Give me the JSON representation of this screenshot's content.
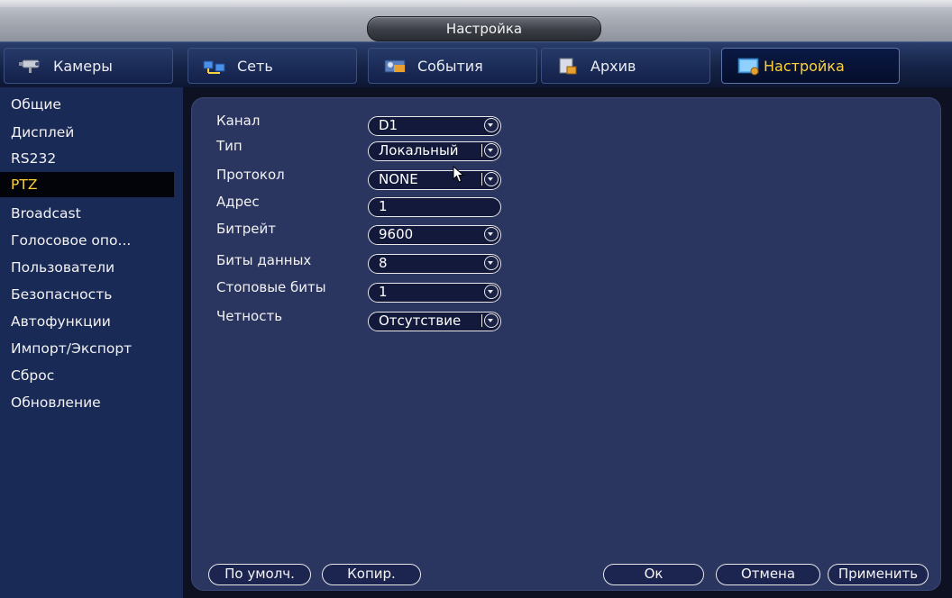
{
  "window": {
    "title": "Настройка"
  },
  "tabs": [
    {
      "label": "Камеры",
      "icon": "camera-icon"
    },
    {
      "label": "Сеть",
      "icon": "network-icon"
    },
    {
      "label": "События",
      "icon": "events-icon"
    },
    {
      "label": "Архив",
      "icon": "archive-icon"
    },
    {
      "label": "Настройка",
      "icon": "settings-icon",
      "active": true
    }
  ],
  "sidebar": {
    "items": [
      {
        "label": "Общие"
      },
      {
        "label": "Дисплей"
      },
      {
        "label": "RS232"
      },
      {
        "label": "PTZ",
        "active": true
      },
      {
        "label": "Broadcast"
      },
      {
        "label": "Голосовое опо..."
      },
      {
        "label": "Пользователи"
      },
      {
        "label": "Безопасность"
      },
      {
        "label": "Автофункции"
      },
      {
        "label": "Импорт/Экспорт"
      },
      {
        "label": "Сброс"
      },
      {
        "label": "Обновление"
      }
    ]
  },
  "form": {
    "channel": {
      "label": "Канал",
      "value": "D1",
      "dropdown": true
    },
    "type": {
      "label": "Тип",
      "value": "Локальный",
      "dropdown": true
    },
    "protocol": {
      "label": "Протокол",
      "value": "NONE",
      "dropdown": true
    },
    "address": {
      "label": "Адрес",
      "value": "1",
      "dropdown": false
    },
    "baudrate": {
      "label": "Битрейт",
      "value": "9600",
      "dropdown": true
    },
    "databits": {
      "label": "Биты данных",
      "value": "8",
      "dropdown": true
    },
    "stopbits": {
      "label": "Стоповые биты",
      "value": "1",
      "dropdown": true
    },
    "parity": {
      "label": "Четность",
      "value": "Отсутствие",
      "dropdown": true
    }
  },
  "buttons": {
    "default": "По умолч.",
    "copy": "Копир.",
    "ok": "Ок",
    "cancel": "Отмена",
    "apply": "Применить"
  },
  "colors": {
    "accent": "#ffd23a",
    "panel": "#2a3560",
    "sidebar": "#1a2a57"
  }
}
